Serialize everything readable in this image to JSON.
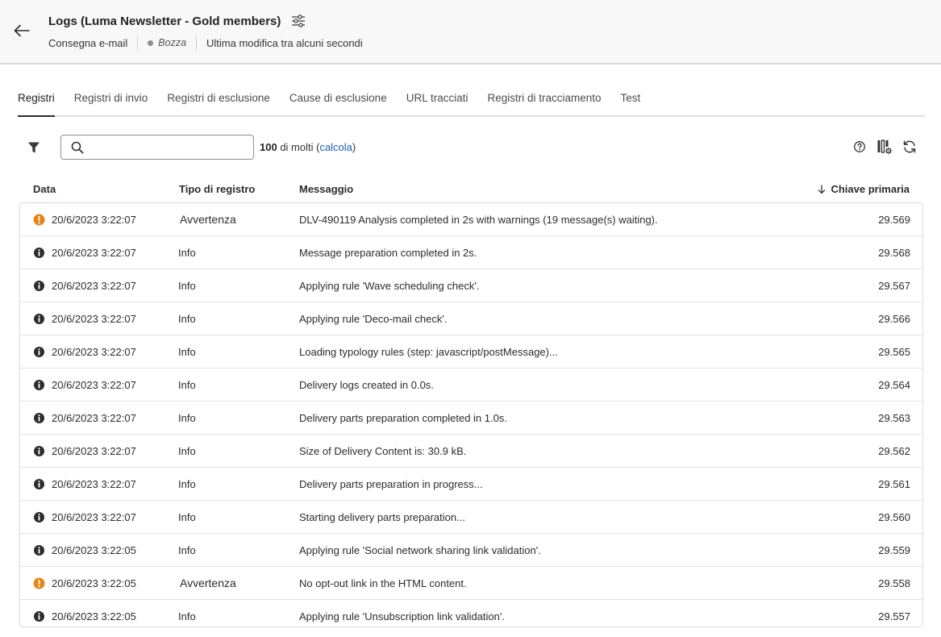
{
  "header": {
    "title": "Logs (Luma Newsletter - Gold members)",
    "channel": "Consegna e-mail",
    "status": "Bozza",
    "last_modified": "Ultima modifica tra alcuni secondi"
  },
  "tabs": [
    {
      "label": "Registri",
      "active": true
    },
    {
      "label": "Registri di invio",
      "active": false
    },
    {
      "label": "Registri di esclusione",
      "active": false
    },
    {
      "label": "Cause di esclusione",
      "active": false
    },
    {
      "label": "URL tracciati",
      "active": false
    },
    {
      "label": "Registri di tracciamento",
      "active": false
    },
    {
      "label": "Test",
      "active": false
    }
  ],
  "toolbar": {
    "search_value": "",
    "count_number": "100",
    "count_suffix": " di molti (",
    "count_link": "calcola",
    "count_close": ")"
  },
  "table": {
    "columns": {
      "date": "Data",
      "type": "Tipo di registro",
      "message": "Messaggio",
      "key": "Chiave primaria"
    },
    "rows": [
      {
        "level": "warning",
        "date": "20/6/2023 3:22:07",
        "type": "Avvertenza",
        "message": "DLV-490119 Analysis completed in 2s with warnings (19 message(s) waiting).",
        "key": "29.569"
      },
      {
        "level": "info",
        "date": "20/6/2023 3:22:07",
        "type": "Info",
        "message": "Message preparation completed in 2s.",
        "key": "29.568"
      },
      {
        "level": "info",
        "date": "20/6/2023 3:22:07",
        "type": "Info",
        "message": "Applying rule 'Wave scheduling check'.",
        "key": "29.567"
      },
      {
        "level": "info",
        "date": "20/6/2023 3:22:07",
        "type": "Info",
        "message": "Applying rule 'Deco-mail check'.",
        "key": "29.566"
      },
      {
        "level": "info",
        "date": "20/6/2023 3:22:07",
        "type": "Info",
        "message": "Loading typology rules (step: javascript/postMessage)...",
        "key": "29.565"
      },
      {
        "level": "info",
        "date": "20/6/2023 3:22:07",
        "type": "Info",
        "message": "Delivery logs created in 0.0s.",
        "key": "29.564"
      },
      {
        "level": "info",
        "date": "20/6/2023 3:22:07",
        "type": "Info",
        "message": "Delivery parts preparation completed in 1.0s.",
        "key": "29.563"
      },
      {
        "level": "info",
        "date": "20/6/2023 3:22:07",
        "type": "Info",
        "message": "Size of Delivery Content is: 30.9 kB.",
        "key": "29.562"
      },
      {
        "level": "info",
        "date": "20/6/2023 3:22:07",
        "type": "Info",
        "message": "Delivery parts preparation in progress...",
        "key": "29.561"
      },
      {
        "level": "info",
        "date": "20/6/2023 3:22:07",
        "type": "Info",
        "message": "Starting delivery parts preparation...",
        "key": "29.560"
      },
      {
        "level": "info",
        "date": "20/6/2023 3:22:05",
        "type": "Info",
        "message": "Applying rule 'Social network sharing link validation'.",
        "key": "29.559"
      },
      {
        "level": "warning",
        "date": "20/6/2023 3:22:05",
        "type": "Avvertenza",
        "message": "No opt-out link in the HTML content.",
        "key": "29.558"
      },
      {
        "level": "info",
        "date": "20/6/2023 3:22:05",
        "type": "Info",
        "message": "Applying rule 'Unsubscription link validation'.",
        "key": "29.557"
      }
    ]
  },
  "colors": {
    "warning": "#e68619",
    "info": "#2c2c2c",
    "link": "#1a5fbf"
  }
}
